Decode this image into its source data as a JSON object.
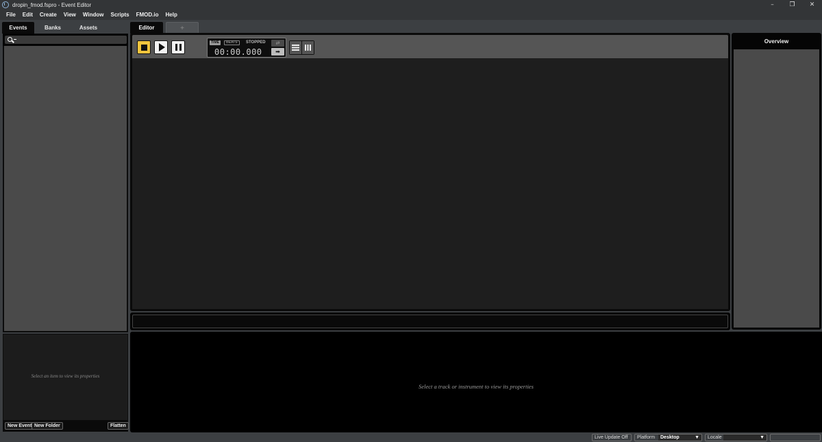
{
  "window": {
    "title": "dropin_fmod.fspro - Event Editor",
    "icon": "fmod-logo-icon",
    "controls": {
      "minimize": "–",
      "restore": "❐",
      "close": "✕"
    }
  },
  "menubar": {
    "items": [
      "File",
      "Edit",
      "Create",
      "View",
      "Window",
      "Scripts",
      "FMOD.io",
      "Help"
    ]
  },
  "left_panel": {
    "tabs": [
      "Events",
      "Banks",
      "Assets"
    ],
    "active_tab": "Events",
    "search": {
      "value": "",
      "icon": "search-icon"
    },
    "properties_hint": "Select an item to view its properties",
    "footer_buttons": {
      "new_event": "New Event",
      "new_folder": "New Folder",
      "flatten": "Flatten"
    }
  },
  "editor": {
    "tabs": {
      "active": "Editor",
      "add": "+"
    },
    "transport": {
      "stop_icon": "stop-icon",
      "play_icon": "play-icon",
      "pause_icon": "pause-icon",
      "time_mode": "TIME",
      "beats_mode": "BEATS",
      "status": "STOPPED",
      "time_value": "00:00.000",
      "loop_glyph": "⇄",
      "follow_glyph": "➡"
    },
    "view_buttons": [
      "list-view-icon",
      "bars-view-icon"
    ]
  },
  "overview": {
    "title": "Overview"
  },
  "bottom_properties": {
    "hint": "Select a track or instrument to view its properties"
  },
  "statusbar": {
    "live_update": "Live Update Off",
    "platform_label": "Platform",
    "platform_value": "Desktop",
    "locale_label": "Locale",
    "locale_value": "",
    "dropdown_arrow": "▼"
  },
  "colors": {
    "accent_stop": "#f2c53d",
    "panel_gray": "#4a4a4a",
    "chrome": "#3c3f42"
  }
}
